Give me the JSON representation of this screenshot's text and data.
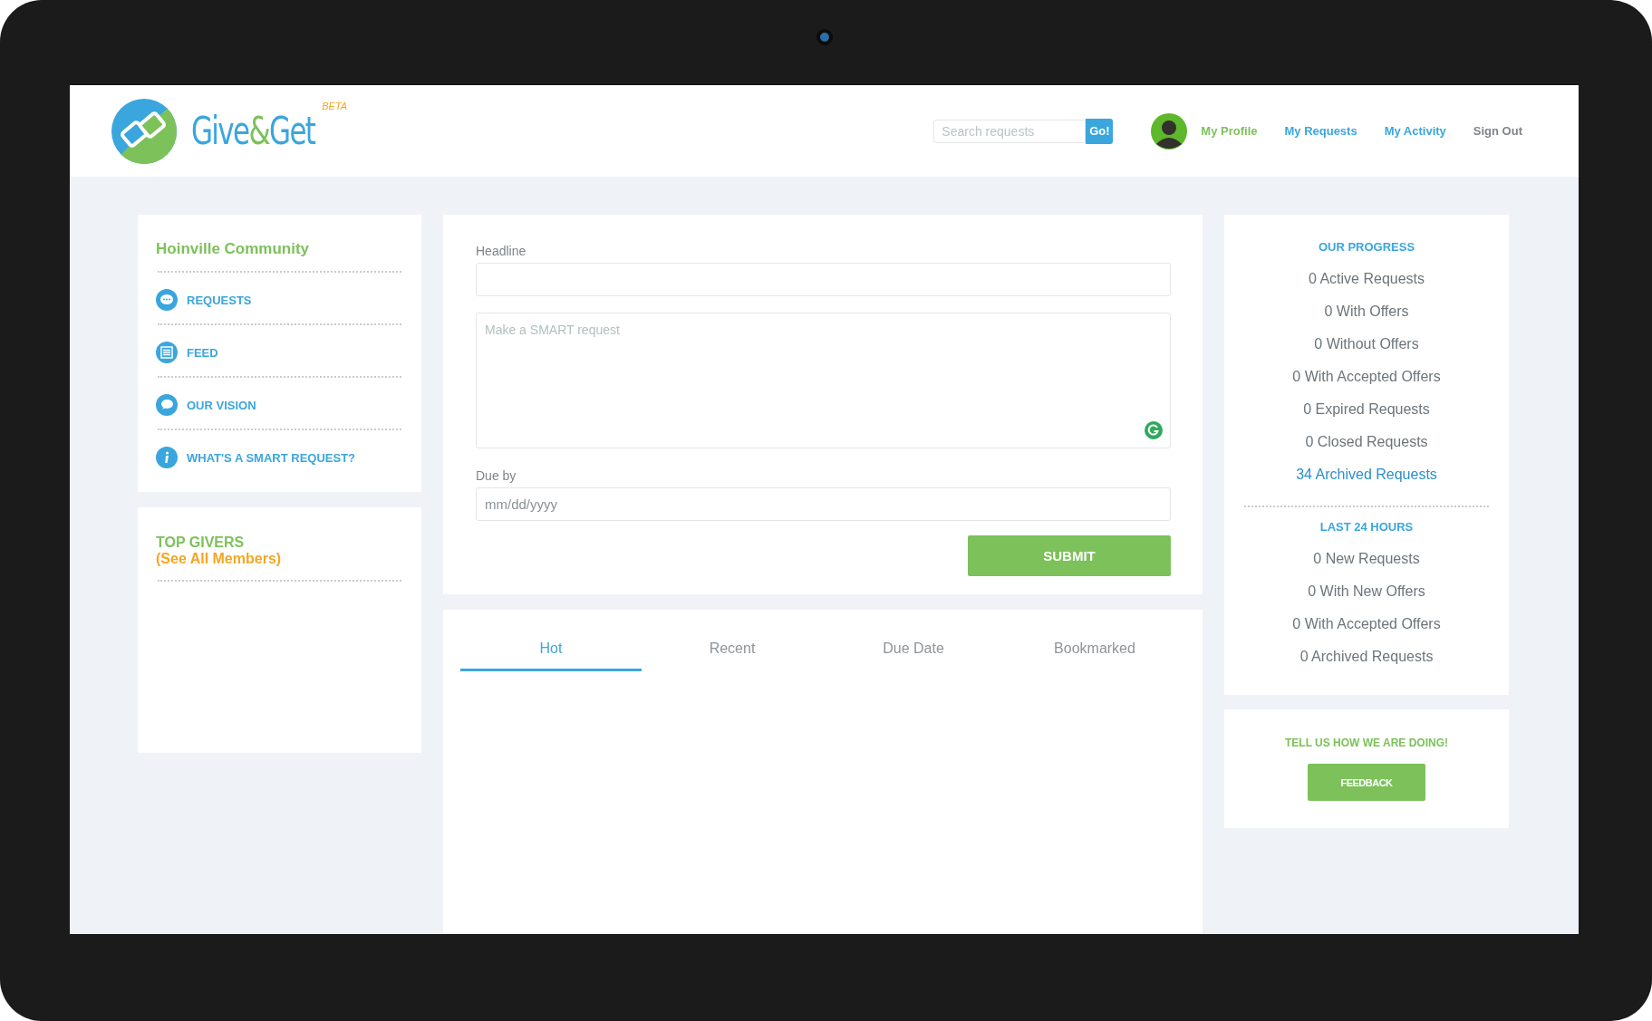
{
  "logo": {
    "parts": [
      {
        "text": "Give",
        "color": "#3aa6dd"
      },
      {
        "text": "&",
        "color": "#7cc15a"
      },
      {
        "text": "Get",
        "color": "#3aa6dd"
      }
    ],
    "badge": "BETA"
  },
  "search": {
    "placeholder": "Search requests",
    "button": "Go!"
  },
  "nav": [
    {
      "label": "My Profile",
      "kind": "profile",
      "color": "#7cc15a"
    },
    {
      "label": "My Requests",
      "kind": "link",
      "color": "#3aa6dd"
    },
    {
      "label": "My Activity",
      "kind": "link",
      "color": "#3aa6dd"
    },
    {
      "label": "Sign Out",
      "kind": "link",
      "color": "#7d858c"
    }
  ],
  "sidebar": {
    "title": "Hoinville Community",
    "items": [
      {
        "label": "REQUESTS",
        "kind": "chat"
      },
      {
        "label": "FEED",
        "kind": "list"
      },
      {
        "label": "OUR VISION",
        "kind": "speech"
      },
      {
        "label": "WHAT'S A SMART REQUEST?",
        "kind": "info"
      }
    ]
  },
  "top_givers": {
    "title": "TOP GIVERS",
    "link": "(See All Members)"
  },
  "form": {
    "headline_label": "Headline",
    "description_placeholder": "Make a SMART request",
    "due_label": "Due by",
    "due_placeholder": "mm/dd/yyyy",
    "submit": "SUBMIT"
  },
  "tabs": [
    {
      "label": "Hot",
      "selected": true
    },
    {
      "label": "Recent",
      "selected": false
    },
    {
      "label": "Due Date",
      "selected": false
    },
    {
      "label": "Bookmarked",
      "selected": false
    }
  ],
  "progress": {
    "title": "OUR PROGRESS",
    "stats": [
      {
        "text": "0 Active Requests",
        "highlighted": false
      },
      {
        "text": "0 With Offers",
        "highlighted": false
      },
      {
        "text": "0 Without Offers",
        "highlighted": false
      },
      {
        "text": "0 With Accepted Offers",
        "highlighted": false
      },
      {
        "text": "0 Expired Requests",
        "highlighted": false
      },
      {
        "text": "0 Closed Requests",
        "highlighted": false
      },
      {
        "text": "34 Archived Requests",
        "highlighted": true
      }
    ],
    "recent_title": "LAST 24 HOURS",
    "recent_stats": [
      {
        "text": "0 New Requests",
        "highlighted": false
      },
      {
        "text": "0 With New Offers",
        "highlighted": false
      },
      {
        "text": "0 With Accepted Offers",
        "highlighted": false
      },
      {
        "text": "0 Archived Requests",
        "highlighted": false
      }
    ]
  },
  "feedback": {
    "prompt": "TELL US HOW WE ARE DOING!",
    "button": "FEEDBACK"
  }
}
